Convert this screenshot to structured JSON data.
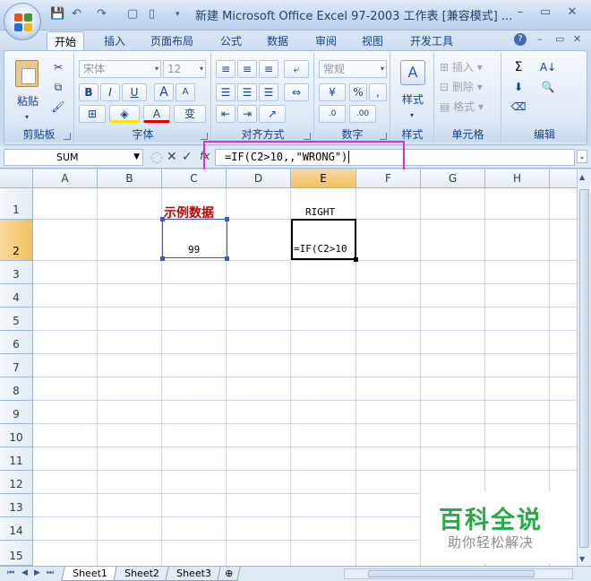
{
  "window": {
    "title": "新建 Microsoft Office Excel 97-2003 工作表 [兼容模式] ...",
    "minimize": "▭",
    "restore": "❐",
    "close": "✕"
  },
  "quick_access": {
    "save": "💾",
    "undo": "↶",
    "redo": "↷",
    "separator": "▾"
  },
  "tabs": [
    "开始",
    "插入",
    "页面布局",
    "公式",
    "数据",
    "审阅",
    "视图",
    "开发工具"
  ],
  "help_icon": "?",
  "ribbon": {
    "clipboard": {
      "label": "剪贴板",
      "paste": "粘贴"
    },
    "font": {
      "label": "字体",
      "font_name": "宋体",
      "font_size": "12",
      "bold": "B",
      "italic": "I",
      "underline": "U",
      "grow": "A",
      "shrink": "A",
      "font_color": "A",
      "phonetic": "变"
    },
    "alignment": {
      "label": "对齐方式"
    },
    "number": {
      "label": "数字",
      "format": "常规",
      "percent": "%",
      "comma": ","
    },
    "styles": {
      "label": "样式",
      "button": "样式"
    },
    "cells": {
      "label": "单元格",
      "insert": "插入",
      "delete": "删除",
      "format": "格式"
    },
    "editing": {
      "label": "编辑",
      "sum": "Σ"
    }
  },
  "formula_bar": {
    "name_box": "SUM",
    "cancel": "✕",
    "enter": "✓",
    "fx": "fx",
    "formula": "=IF(C2>10,,\"WRONG\")"
  },
  "columns": [
    "A",
    "B",
    "C",
    "D",
    "E",
    "F",
    "G",
    "H"
  ],
  "selected_column": "E",
  "rows": [
    "1",
    "2",
    "3",
    "4",
    "5",
    "6",
    "7",
    "8",
    "9",
    "10",
    "11",
    "12",
    "13",
    "14",
    "15"
  ],
  "selected_row": "2",
  "cells": {
    "C1": "示例数据",
    "C2": "99",
    "E1": "RIGHT",
    "E2": "=IF(C2>10"
  },
  "watermark": {
    "main": "百科全说",
    "sub": "助你轻松解决"
  },
  "sheets": [
    "Sheet1",
    "Sheet2",
    "Sheet3"
  ],
  "active_sheet": "Sheet1",
  "accent_colors": {
    "highlight_box": "#d232d2",
    "title_red": "#c00000",
    "watermark_green": "#2aa84a"
  }
}
